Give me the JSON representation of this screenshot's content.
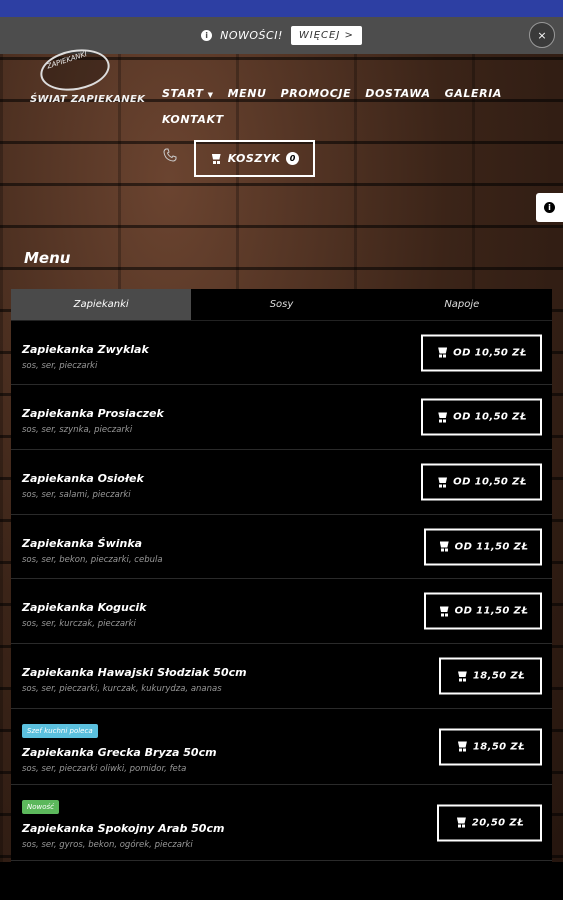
{
  "notice": {
    "text": "NOWOŚCI!",
    "more_label": "WIĘCEJ >",
    "close_label": "×",
    "info_glyph": "i"
  },
  "logo": {
    "badge_text": "ZAPIEKANKI",
    "text": "ŚWIAT ZAPIEKANEK"
  },
  "nav": {
    "items": [
      "START",
      "MENU",
      "PROMOCJE",
      "DOSTAWA",
      "GALERIA",
      "KONTAKT"
    ],
    "start_caret": "▼"
  },
  "cart": {
    "label": "KOSZYK",
    "count": "0"
  },
  "side_info_glyph": "i",
  "menu": {
    "title": "Menu",
    "tabs": [
      "Zapiekanki",
      "Sosy",
      "Napoje"
    ],
    "active_tab": "Zapiekanki",
    "items": [
      {
        "name": "Zapiekanka Zwyklak",
        "desc": "sos, ser, pieczarki",
        "price": "OD 10,50 ZŁ",
        "badge": ""
      },
      {
        "name": "Zapiekanka Prosiaczek",
        "desc": "sos, ser, szynka, pieczarki",
        "price": "OD 10,50 ZŁ",
        "badge": ""
      },
      {
        "name": "Zapiekanka Osiołek",
        "desc": "sos, ser, salami, pieczarki",
        "price": "OD 10,50 ZŁ",
        "badge": ""
      },
      {
        "name": "Zapiekanka Świnka",
        "desc": "sos, ser, bekon, pieczarki, cebula",
        "price": "OD 11,50 ZŁ",
        "badge": ""
      },
      {
        "name": "Zapiekanka Kogucik",
        "desc": "sos, ser, kurczak, pieczarki",
        "price": "OD 11,50 ZŁ",
        "badge": ""
      },
      {
        "name": "Zapiekanka Hawajski Słodziak 50cm",
        "desc": "sos, ser, pieczarki, kurczak, kukurydza, ananas",
        "price": "18,50 ZŁ",
        "badge": ""
      },
      {
        "name": "Zapiekanka Grecka Bryza 50cm",
        "desc": "sos, ser, pieczarki oliwki, pomidor, feta",
        "price": "18,50 ZŁ",
        "badge": "Szef kuchni poleca",
        "badge_color": "#5bc0de"
      },
      {
        "name": "Zapiekanka Spokojny Arab 50cm",
        "desc": "sos, ser, gyros, bekon, ogórek, pieczarki",
        "price": "20,50 ZŁ",
        "badge": "Nowość",
        "badge_color": "#5cb85c"
      }
    ]
  },
  "colors": {
    "topbar": "#2d3fa3",
    "notice_bg": "#4d4d4d",
    "panel_bg": "#000000",
    "active_tab": "#4a4a4a"
  }
}
